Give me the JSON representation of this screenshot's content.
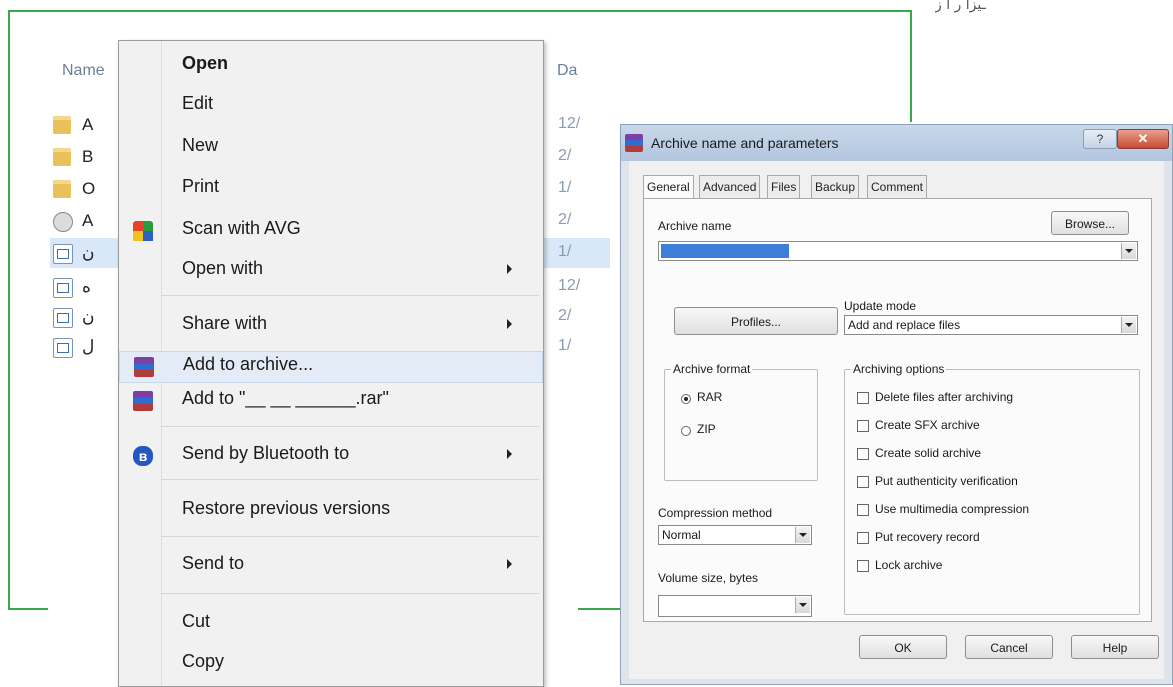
{
  "corner_text": "ـیزا ر ا ز",
  "explorer": {
    "name_header": "Name",
    "date_header": "Da",
    "rows": [
      {
        "name": "A",
        "date": "12/",
        "icon": "folder-icon"
      },
      {
        "name": "B",
        "date": "2/",
        "icon": "folder-icon"
      },
      {
        "name": "O",
        "date": "1/",
        "icon": "folder-icon"
      },
      {
        "name": "A",
        "date": "2/",
        "icon": "archive-icon"
      },
      {
        "name": "ن",
        "date": "1/",
        "icon": "document-icon"
      },
      {
        "name": "ه",
        "date": "12/",
        "icon": "document-icon"
      },
      {
        "name": "ن",
        "date": "2/",
        "icon": "document-icon"
      },
      {
        "name": "ل",
        "date": "1/",
        "icon": "document-icon"
      }
    ]
  },
  "context_menu": {
    "open": "Open",
    "edit": "Edit",
    "new": "New",
    "print": "Print",
    "scan": "Scan with AVG",
    "open_with": "Open with",
    "share_with": "Share with",
    "add_to_archive": "Add to archive...",
    "add_to_rar": "Add to \"__ __ ______.rar\"",
    "send_bluetooth": "Send by Bluetooth to",
    "restore": "Restore previous versions",
    "send_to": "Send to",
    "cut": "Cut",
    "copy": "Copy"
  },
  "dialog": {
    "title": "Archive name and parameters",
    "help_btn": "?",
    "close_btn": "✕",
    "tabs": [
      "General",
      "Advanced",
      "Files",
      "Backup",
      "Comment"
    ],
    "archive_name_label": "Archive name",
    "browse": "Browse...",
    "profiles": "Profiles...",
    "update_mode_label": "Update mode",
    "update_mode_value": "Add and replace files",
    "archive_format_label": "Archive format",
    "formats": [
      {
        "label": "RAR",
        "selected": true
      },
      {
        "label": "ZIP",
        "selected": false
      }
    ],
    "archiving_options_label": "Archiving options",
    "options": [
      "Delete files after archiving",
      "Create SFX archive",
      "Create solid archive",
      "Put authenticity verification",
      "Use multimedia compression",
      "Put recovery record",
      "Lock archive"
    ],
    "compression_label": "Compression method",
    "compression_value": "Normal",
    "volume_label": "Volume size, bytes",
    "ok": "OK",
    "cancel": "Cancel",
    "help": "Help"
  },
  "colors": {
    "frame_green": "#3aa84a",
    "selection_blue": "#3d7fd8"
  }
}
